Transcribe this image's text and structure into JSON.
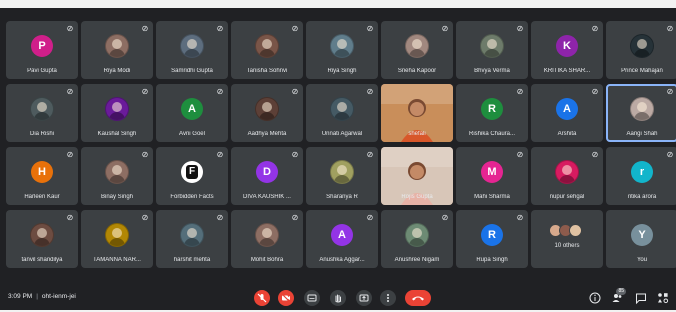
{
  "colors": {
    "background": "#202124",
    "tile": "#3c4043",
    "text": "#e8eaed",
    "end_call": "#ea4335",
    "active_speaker": "#8ab4f8"
  },
  "participants": [
    {
      "name": "Pavi Gupta",
      "initial": "P",
      "kind": "letter",
      "color": "#d01f8a"
    },
    {
      "name": "Riya Modi",
      "initial": "",
      "kind": "photo",
      "color": "#8d6e63"
    },
    {
      "name": "Samridhi Gupta",
      "initial": "",
      "kind": "photo",
      "color": "#5d6d7e"
    },
    {
      "name": "Tanisha Sohnvi",
      "initial": "",
      "kind": "photo",
      "color": "#795548"
    },
    {
      "name": "Riya Singh",
      "initial": "",
      "kind": "photo",
      "color": "#607d8b"
    },
    {
      "name": "Sneha Kapoor",
      "initial": "",
      "kind": "photo",
      "color": "#a1887f"
    },
    {
      "name": "Bhvya Verma",
      "initial": "",
      "kind": "photo",
      "color": "#6d7b6a"
    },
    {
      "name": "KRITIKA SHAR...",
      "initial": "K",
      "kind": "letter",
      "color": "#8e24aa"
    },
    {
      "name": "Prince Mahajan",
      "initial": "",
      "kind": "photo",
      "color": "#263238"
    },
    {
      "name": "Dia Rishi",
      "initial": "",
      "kind": "photo",
      "color": "#4e5b5e"
    },
    {
      "name": "Kaushal Singh",
      "initial": "",
      "kind": "photo",
      "color": "#6a1b9a"
    },
    {
      "name": "Avni Goel",
      "initial": "A",
      "kind": "letter",
      "color": "#1e8e3e"
    },
    {
      "name": "Aadhya Mehta",
      "initial": "",
      "kind": "photo",
      "color": "#5d4037"
    },
    {
      "name": "Unnati Agarwal",
      "initial": "",
      "kind": "photo",
      "color": "#455a64"
    },
    {
      "name": "shefali",
      "initial": "",
      "kind": "video",
      "color": "#c98e5a"
    },
    {
      "name": "Rishika Chaura...",
      "initial": "R",
      "kind": "letter",
      "color": "#1e8e3e"
    },
    {
      "name": "Arshita",
      "initial": "A",
      "kind": "letter",
      "color": "#1a73e8"
    },
    {
      "name": "Aangi Shah",
      "initial": "",
      "kind": "photo",
      "color": "#bcaaa4",
      "active": true
    },
    {
      "name": "Harleen Kaur",
      "initial": "H",
      "kind": "letter",
      "color": "#e8710a"
    },
    {
      "name": "Binay Singh",
      "initial": "",
      "kind": "photo",
      "color": "#8d6e63"
    },
    {
      "name": "Forbidden Facts",
      "initial": "F",
      "kind": "ff",
      "color": "#ffffff"
    },
    {
      "name": "DIVA KAUSHIK ...",
      "initial": "D",
      "kind": "letter",
      "color": "#9334e6"
    },
    {
      "name": "Sharanya R",
      "initial": "",
      "kind": "photo",
      "color": "#a0a060"
    },
    {
      "name": "Rojis Gupta",
      "initial": "",
      "kind": "video",
      "color": "#d8c6b8"
    },
    {
      "name": "Mahi Sharma",
      "initial": "M",
      "kind": "letter",
      "color": "#e52592"
    },
    {
      "name": "nupur sehgal",
      "initial": "",
      "kind": "photo",
      "color": "#d81b60"
    },
    {
      "name": "ritika arora",
      "initial": "r",
      "kind": "letter",
      "color": "#12b5cb"
    },
    {
      "name": "tanvil shandilya",
      "initial": "",
      "kind": "photo",
      "color": "#6d4c41"
    },
    {
      "name": "TAMANNA NAR...",
      "initial": "",
      "kind": "photo",
      "color": "#b28704"
    },
    {
      "name": "harshit mehta",
      "initial": "",
      "kind": "photo",
      "color": "#546e7a"
    },
    {
      "name": "Mohit Bohra",
      "initial": "",
      "kind": "photo",
      "color": "#8d6e63"
    },
    {
      "name": "Anushka Aggar...",
      "initial": "A",
      "kind": "letter",
      "color": "#9334e6"
    },
    {
      "name": "Anushree Nigam",
      "initial": "",
      "kind": "photo",
      "color": "#6d8b74"
    },
    {
      "name": "Rupa Singh",
      "initial": "R",
      "kind": "letter",
      "color": "#1a73e8"
    },
    {
      "name": "",
      "initial": "",
      "kind": "others",
      "color": "#3c4043",
      "others_label": "10 others"
    },
    {
      "name": "You",
      "initial": "Y",
      "kind": "letter",
      "color": "#78909c"
    }
  ],
  "bottom_bar": {
    "time": "3:09 PM",
    "meeting_code": "oht-ienm-jei",
    "badge_count": "85"
  },
  "icons": {
    "mic_off": "mic-off-icon",
    "cam_off": "camera-off-icon",
    "captions": "captions-icon",
    "raise_hand": "hand-icon",
    "present": "present-icon",
    "more": "more-options-icon",
    "end_call": "end-call-icon",
    "info": "info-icon",
    "people": "people-icon",
    "chat": "chat-icon",
    "activities": "activities-icon"
  }
}
